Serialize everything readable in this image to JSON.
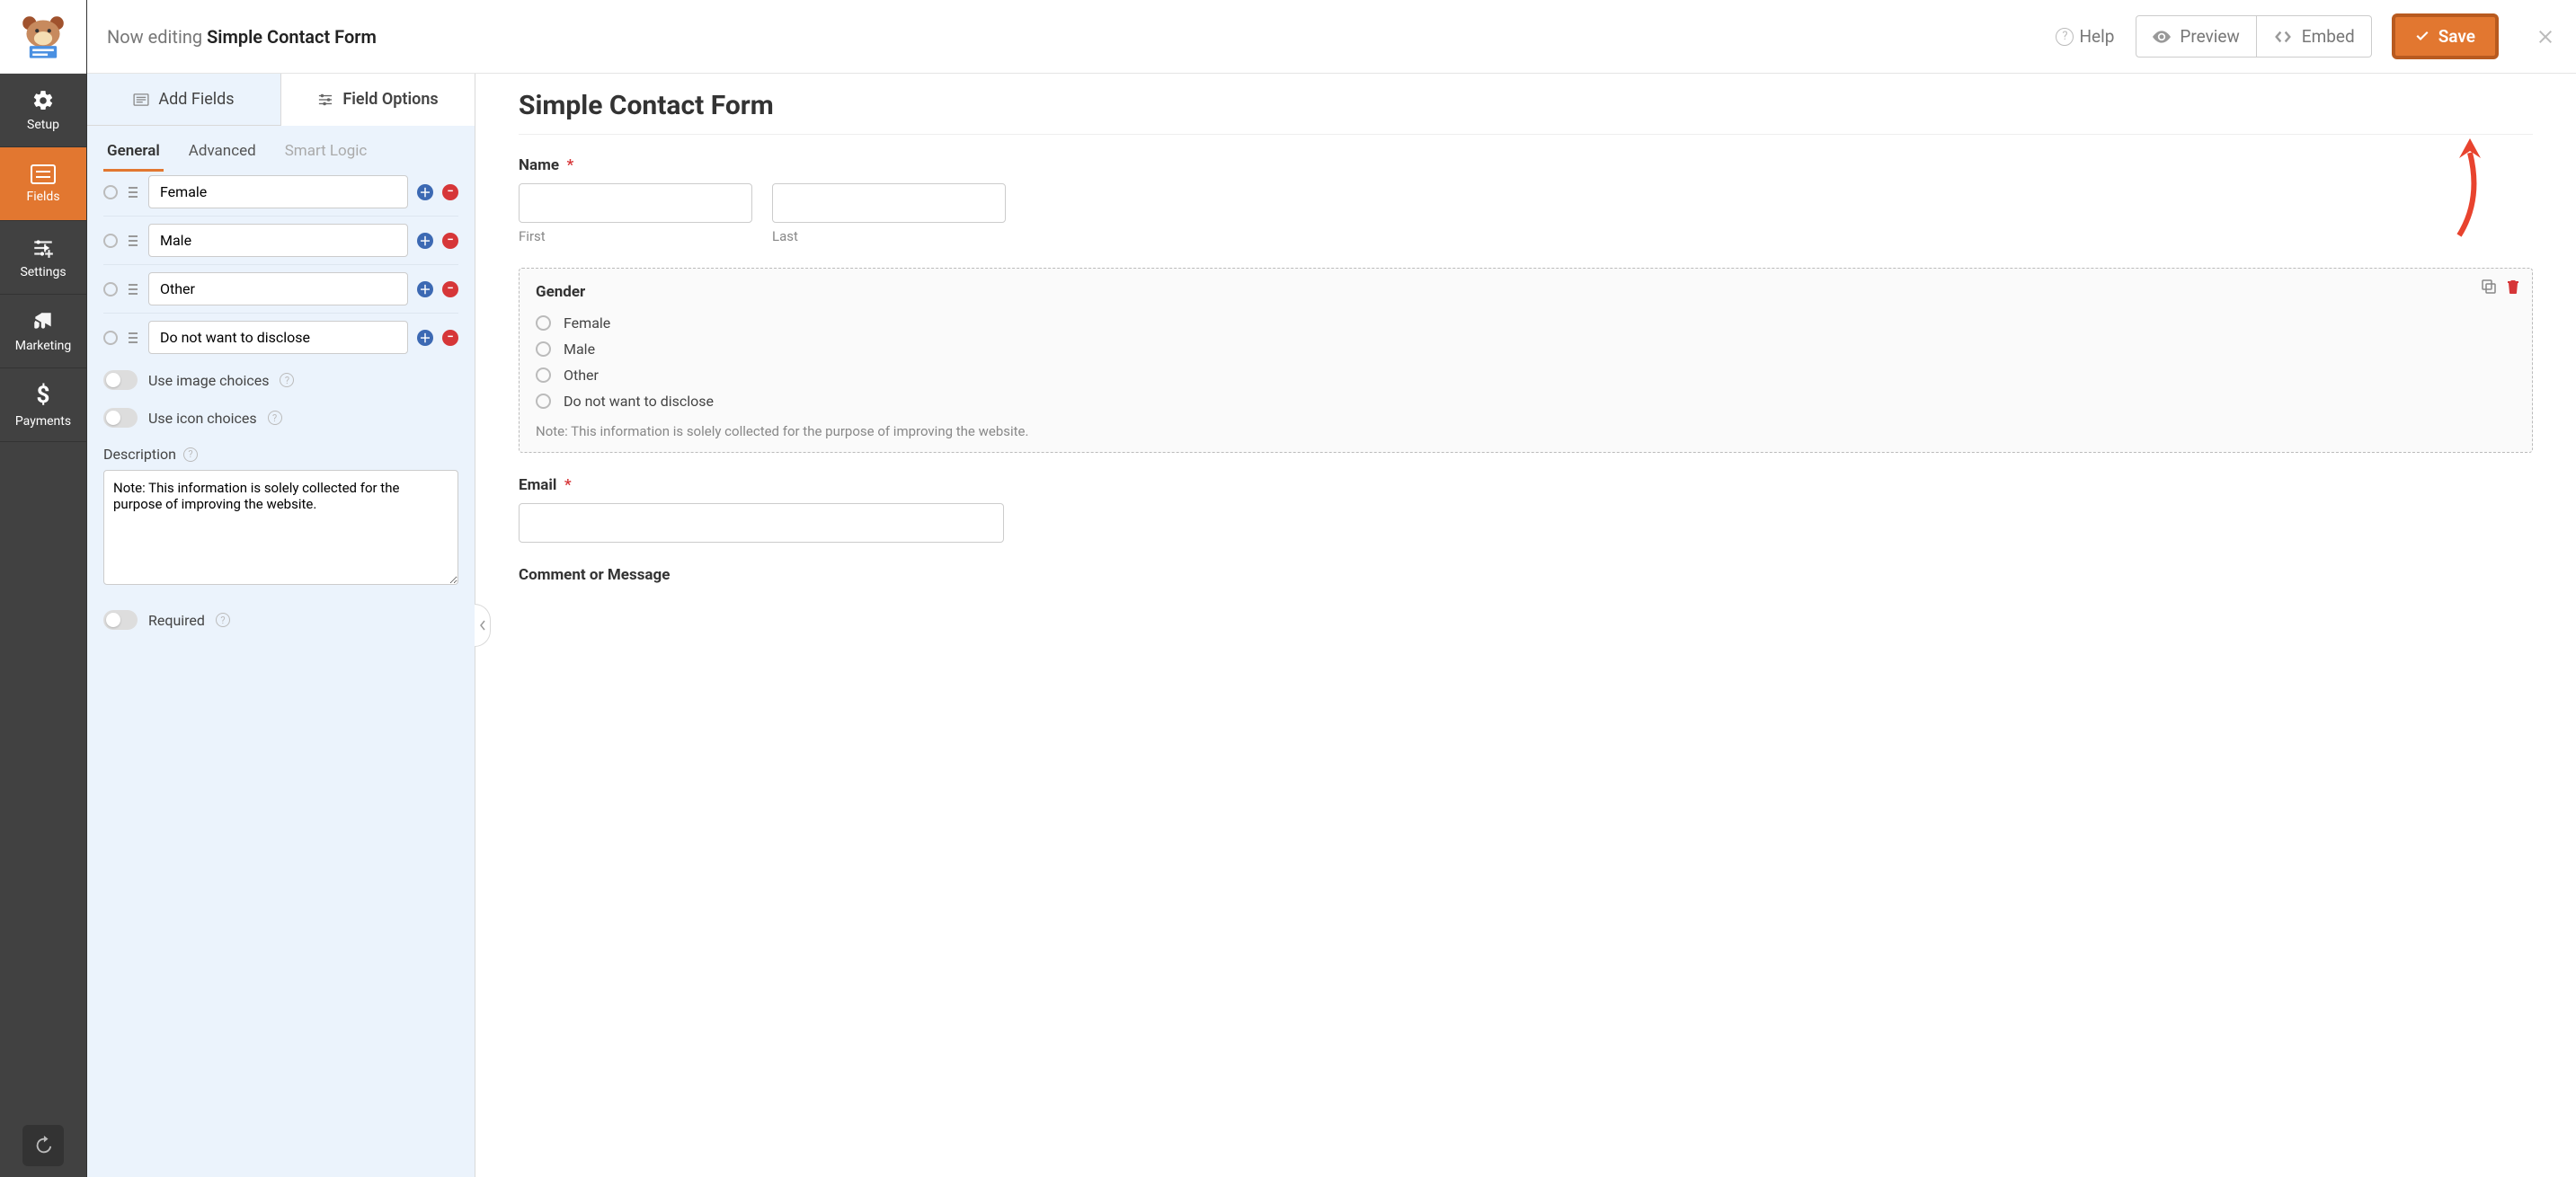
{
  "topbar": {
    "now_editing_prefix": "Now editing ",
    "form_name": "Simple Contact Form",
    "help": "Help",
    "preview": "Preview",
    "embed": "Embed",
    "save": "Save"
  },
  "rail": {
    "setup": "Setup",
    "fields": "Fields",
    "settings": "Settings",
    "marketing": "Marketing",
    "payments": "Payments"
  },
  "panel": {
    "tab_add": "Add Fields",
    "tab_options": "Field Options",
    "sub_general": "General",
    "sub_advanced": "Advanced",
    "sub_smart": "Smart Logic",
    "choices": [
      "Female",
      "Male",
      "Other",
      "Do not want to disclose"
    ],
    "use_image": "Use image choices",
    "use_icon": "Use icon choices",
    "description_label": "Description",
    "description_value": "Note: This information is solely collected for the purpose of improving the website.",
    "required": "Required"
  },
  "form": {
    "title": "Simple Contact Form",
    "name_label": "Name",
    "first": "First",
    "last": "Last",
    "gender_label": "Gender",
    "gender_options": [
      "Female",
      "Male",
      "Other",
      "Do not want to disclose"
    ],
    "gender_desc": "Note: This information is solely collected for the purpose of improving the website.",
    "email_label": "Email",
    "comment_label": "Comment or Message"
  }
}
